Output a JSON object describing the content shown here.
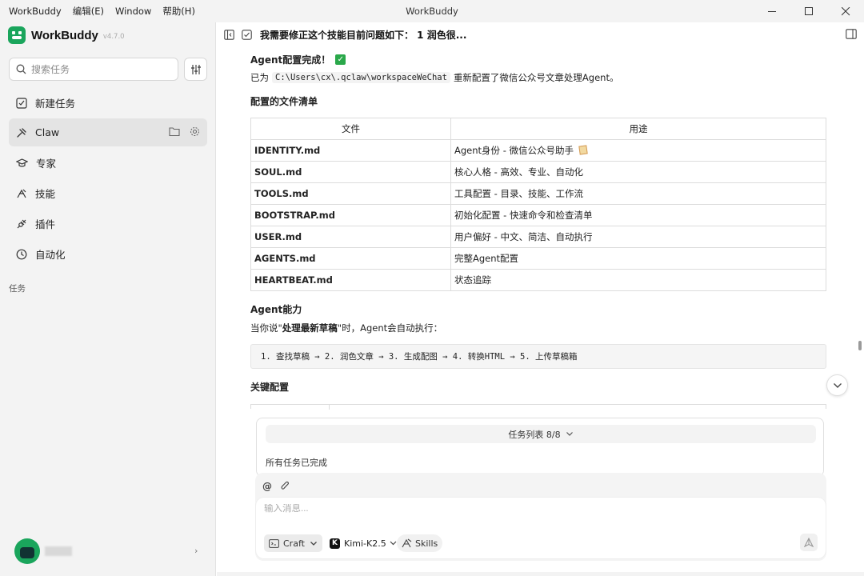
{
  "window": {
    "menu": [
      "WorkBuddy",
      "编辑(E)",
      "Window",
      "帮助(H)"
    ],
    "title": "WorkBuddy"
  },
  "sidebar": {
    "brand": "WorkBuddy",
    "version": "v4.7.0",
    "search_placeholder": "搜索任务",
    "items": [
      {
        "label": "新建任务",
        "icon": "edit-square-icon"
      },
      {
        "label": "Claw",
        "icon": "claw-icon"
      },
      {
        "label": "专家",
        "icon": "graduation-cap-icon"
      },
      {
        "label": "技能",
        "icon": "skills-icon"
      },
      {
        "label": "插件",
        "icon": "plug-icon"
      },
      {
        "label": "自动化",
        "icon": "clock-icon"
      }
    ],
    "section_label": "任务"
  },
  "main": {
    "header_title": "我需要修正这个技能目前问题如下： 1 润色很...",
    "done_title": "Agent配置完成！",
    "path_prefix": "已为",
    "path": "C:\\Users\\cx\\.qclaw\\workspaceWeChat",
    "path_suffix": "重新配置了微信公众号文章处理Agent。",
    "files_heading": "配置的文件清单",
    "table": {
      "headers": [
        "文件",
        "用途"
      ],
      "rows": [
        {
          "file": "IDENTITY.md",
          "purpose": "Agent身份 - 微信公众号助手"
        },
        {
          "file": "SOUL.md",
          "purpose": "核心人格 - 高效、专业、自动化"
        },
        {
          "file": "TOOLS.md",
          "purpose": "工具配置 - 目录、技能、工作流"
        },
        {
          "file": "BOOTSTRAP.md",
          "purpose": "初始化配置 - 快速命令和检查清单"
        },
        {
          "file": "USER.md",
          "purpose": "用户偏好 - 中文、简洁、自动执行"
        },
        {
          "file": "AGENTS.md",
          "purpose": "完整Agent配置"
        },
        {
          "file": "HEARTBEAT.md",
          "purpose": "状态追踪"
        }
      ]
    },
    "ability_heading": "Agent能力",
    "ability_prefix": "当你说\"",
    "ability_keyword": "处理最新草稿",
    "ability_suffix": "\"时，Agent会自动执行：",
    "pipeline": "1. 查找草稿 → 2. 润色文章 → 3. 生成配图 → 4. 转换HTML → 5. 上传草稿箱",
    "key_config_heading": "关键配置"
  },
  "tasks": {
    "list_label": "任务列表 8/8",
    "status": "所有任务已完成"
  },
  "composer": {
    "placeholder": "输入消息...",
    "mode": "Craft",
    "model": "Kimi-K2.5",
    "skills": "Skills"
  }
}
